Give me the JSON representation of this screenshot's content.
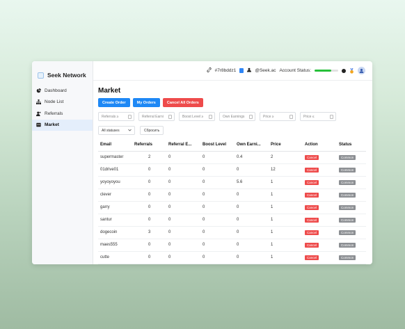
{
  "brand": {
    "name": "Seek Network"
  },
  "sidebar": {
    "items": [
      {
        "label": "Dashboard",
        "icon": "dashboard-icon"
      },
      {
        "label": "Node List",
        "icon": "nodes-icon"
      },
      {
        "label": "Referrals",
        "icon": "add-user-icon"
      },
      {
        "label": "Market",
        "icon": "market-icon",
        "active": true
      }
    ]
  },
  "topbar": {
    "node_id": "#7r8bddz1",
    "user": "@Seek.ac",
    "account_status_label": "Account Status:",
    "status_progress": 0.7,
    "accent": "#27c03a"
  },
  "main": {
    "title": "Market",
    "buttons": {
      "create": "Create Order",
      "mine": "My Orders",
      "cancel_all": "Cancel All Orders"
    },
    "filters": [
      "Referrals ≥",
      "Referral Earni",
      "Boost Level ≥",
      "Own Earnings",
      "Price ≥",
      "Price ≤"
    ],
    "status_select": "All statuses",
    "reset": "Сбросить"
  },
  "table": {
    "headers": [
      "Email",
      "Referrals",
      "Referral E...",
      "Boost Level",
      "Own Earni...",
      "Price",
      "Action",
      "Status"
    ],
    "rows": [
      [
        "supermaster",
        "2",
        "0",
        "0",
        "0.4",
        "2",
        "Cancel",
        "Common"
      ],
      [
        "01drive01",
        "0",
        "0",
        "0",
        "0",
        "12",
        "Cancel",
        "Common"
      ],
      [
        "yoyoyoyou",
        "0",
        "0",
        "0",
        "5.6",
        "1",
        "Cancel",
        "Common"
      ],
      [
        "clever",
        "0",
        "0",
        "0",
        "0",
        "1",
        "Cancel",
        "Common"
      ],
      [
        "garry",
        "0",
        "0",
        "0",
        "0",
        "1",
        "Cancel",
        "Common"
      ],
      [
        "santur",
        "0",
        "0",
        "0",
        "0",
        "1",
        "Cancel",
        "Common"
      ],
      [
        "dogecoin",
        "3",
        "0",
        "0",
        "0",
        "1",
        "Cancel",
        "Common"
      ],
      [
        "maes555",
        "0",
        "0",
        "0",
        "0",
        "1",
        "Cancel",
        "Common"
      ],
      [
        "cutte",
        "0",
        "0",
        "0",
        "0",
        "1",
        "Cancel",
        "Common"
      ]
    ]
  }
}
